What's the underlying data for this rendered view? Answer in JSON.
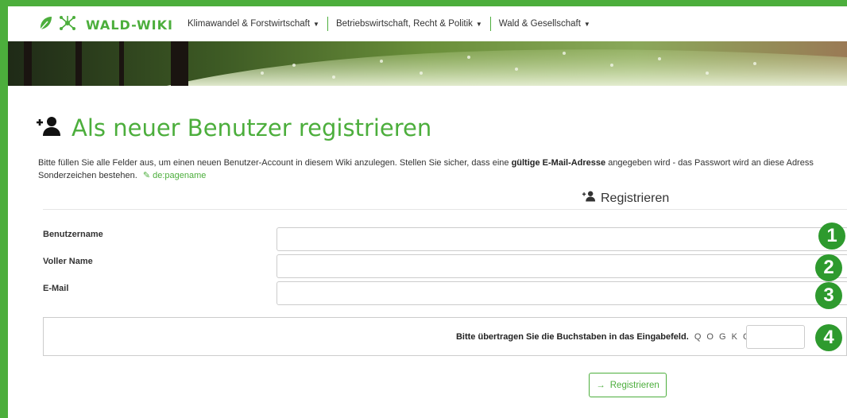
{
  "logo": {
    "text": "WALD-WIKI"
  },
  "nav": {
    "items": [
      {
        "label": "Klimawandel & Forstwirtschaft"
      },
      {
        "label": "Betriebswirtschaft, Recht & Politik"
      },
      {
        "label": "Wald & Gesellschaft"
      }
    ]
  },
  "page": {
    "title": "Als neuer Benutzer registrieren",
    "intro_part1": "Bitte füllen Sie alle Felder aus, um einen neuen Benutzer-Account in diesem Wiki anzulegen. Stellen Sie sicher, dass eine ",
    "intro_bold": "gültige E-Mail-Adresse",
    "intro_part2": " angegeben wird - das Passwort wird an diese Adress",
    "intro_line2": "Sonderzeichen bestehen.",
    "intro_link": "de:pagename",
    "section_heading": "Registrieren"
  },
  "form": {
    "username_label": "Benutzername",
    "fullname_label": "Voller Name",
    "email_label": "E-Mail",
    "username_value": "",
    "fullname_value": "",
    "email_value": "",
    "captcha_label": "Bitte übertragen Sie die Buchstaben in das Eingabefeld.",
    "captcha_code": "Q O G K C",
    "captcha_value": "",
    "submit_label": "Registrieren"
  },
  "badges": [
    "1",
    "2",
    "3",
    "4"
  ],
  "colors": {
    "accent": "#4cae3c",
    "badge": "#2e9a2e"
  }
}
